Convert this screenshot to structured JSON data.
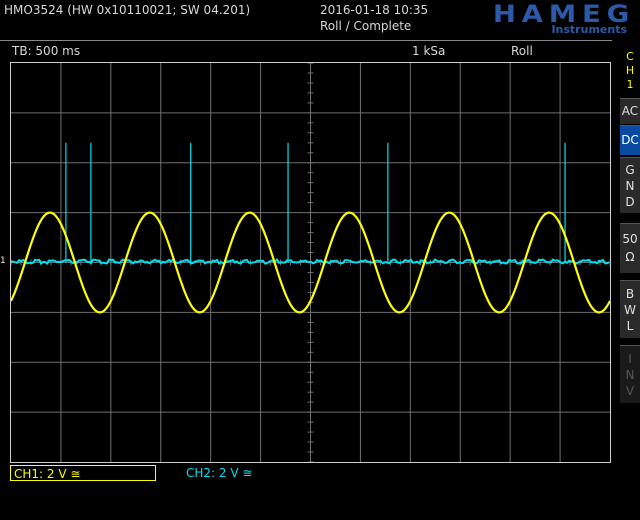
{
  "header": {
    "model": "HMO3524",
    "version": "(HW 0x10110021; SW 04.201)",
    "datetime": "2016-01-18 10:35",
    "status": "Roll / Complete",
    "brand": "HAMEG",
    "brand_sub": "Instruments"
  },
  "info_bar": {
    "timebase": "TB: 500 ms",
    "sample_rate": "1 kSa",
    "mode": "Roll"
  },
  "side_menu": {
    "channel_chars": [
      "C",
      "H",
      "1"
    ],
    "ac": "AC",
    "dc": "DC",
    "gnd_chars": [
      "G",
      "N",
      "D"
    ],
    "imp_top": "50",
    "imp_bottom": "Ω",
    "bwl_chars": [
      "B",
      "W",
      "L"
    ],
    "inv_chars": [
      "I",
      "N",
      "V"
    ]
  },
  "channels": {
    "ch1": "CH1: 2 V ≅",
    "ch2": "CH2: 2 V ≅"
  },
  "colors": {
    "ch1": "#ffff00",
    "ch2": "#00e0f0",
    "grid": "#707070",
    "brand": "#2a5aa8",
    "active": "#0a4aa0"
  },
  "marker": "1",
  "chart_data": {
    "type": "line",
    "x_divisions": 12,
    "y_divisions": 8,
    "series": [
      {
        "channel": "CH1",
        "shape": "sine",
        "cycles_on_screen": 6,
        "amplitude_div": 1.0,
        "offset_div": 0
      },
      {
        "channel": "CH2",
        "shape": "baseline with spikes",
        "offset_div": 0,
        "spike_x_div": [
          1.1,
          1.6,
          3.6,
          5.55,
          7.55,
          11.1
        ],
        "spike_height_div": 2.4
      }
    ]
  }
}
